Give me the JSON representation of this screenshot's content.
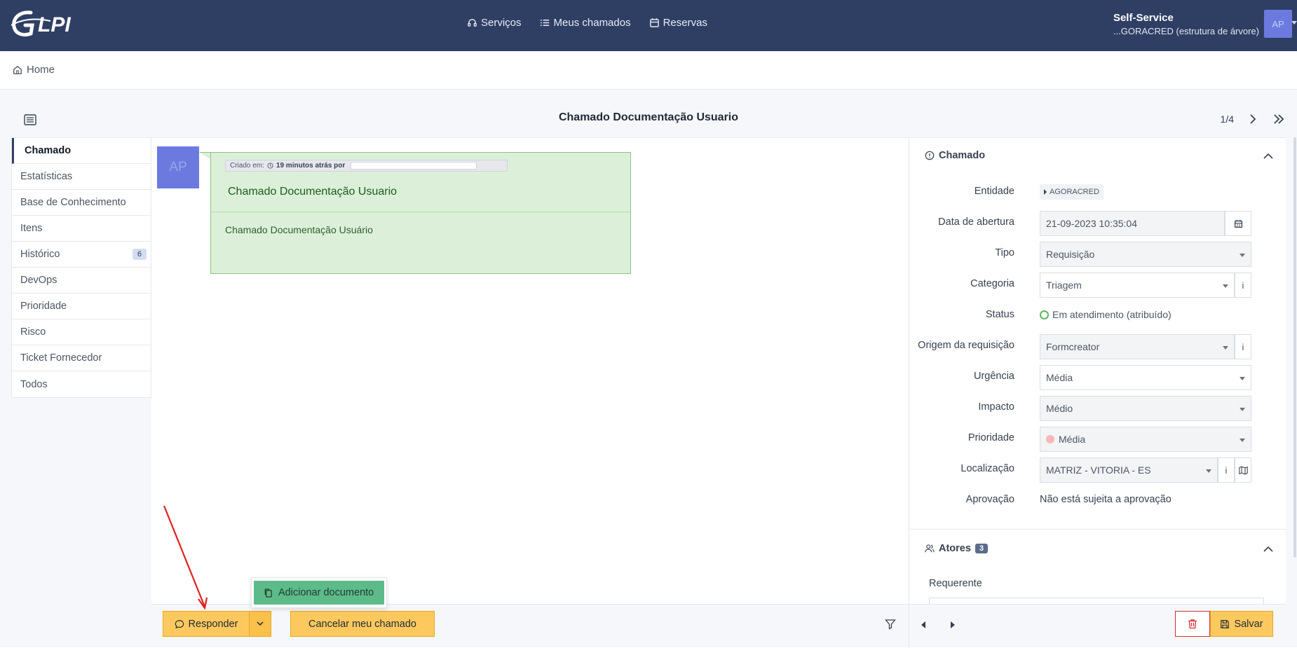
{
  "app": {
    "logo_text": "GLPI"
  },
  "topnav": {
    "items": [
      {
        "label": "Serviços",
        "icon": "headset-icon"
      },
      {
        "label": "Meus chamados",
        "icon": "list-icon"
      },
      {
        "label": "Reservas",
        "icon": "calendar-icon"
      }
    ]
  },
  "profile": {
    "title": "Self-Service",
    "entity": "...GORACRED (estrutura de árvore)",
    "avatar_initials": "AP"
  },
  "breadcrumb": {
    "home_label": "Home"
  },
  "page": {
    "title": "Chamado Documentação Usuario",
    "pager": "1/4"
  },
  "tabs": [
    {
      "label": "Chamado",
      "active": true
    },
    {
      "label": "Estatísticas"
    },
    {
      "label": "Base de Conhecimento"
    },
    {
      "label": "Itens"
    },
    {
      "label": "Histórico",
      "badge": "6"
    },
    {
      "label": "DevOps"
    },
    {
      "label": "Prioridade"
    },
    {
      "label": "Risco"
    },
    {
      "label": "Ticket Fornecedor"
    },
    {
      "label": "Todos"
    }
  ],
  "timeline": {
    "avatar_initials": "AP",
    "created_label": "Criado em:",
    "created_when": "19 minutos atrás por",
    "title": "Chamado Documentação Usuario",
    "body": "Chamado Documentação Usuário",
    "bubble_color": "#dcf0d9"
  },
  "ticket_panel": {
    "section_title": "Chamado",
    "fields": {
      "entidade_label": "Entidade",
      "entidade_value": "AGORACRED",
      "data_label": "Data de abertura",
      "data_value": "21-09-2023 10:35:04",
      "tipo_label": "Tipo",
      "tipo_value": "Requisição",
      "categoria_label": "Categoria",
      "categoria_value": "Triagem",
      "status_label": "Status",
      "status_value": "Em atendimento (atribuído)",
      "origem_label": "Origem da requisição",
      "origem_value": "Formcreator",
      "urgencia_label": "Urgência",
      "urgencia_value": "Média",
      "impacto_label": "Impacto",
      "impacto_value": "Médio",
      "prioridade_label": "Prioridade",
      "prioridade_value": "Média",
      "localizacao_label": "Localização",
      "localizacao_value": "MATRIZ - VITORIA - ES",
      "aprovacao_label": "Aprovação",
      "aprovacao_value": "Não está sujeita a aprovação"
    },
    "info_glyph": "i",
    "actors_title": "Atores",
    "actors_count": "3",
    "requerente_label": "Requerente"
  },
  "bottom": {
    "responder_label": "Responder",
    "cancel_label": "Cancelar meu chamado",
    "save_label": "Salvar"
  },
  "dropdown": {
    "add_document_label": "Adicionar documento"
  },
  "colors": {
    "navbar": "#2f3f64",
    "button_warning": "#fdc95e",
    "dropdown_active": "#5dbb8a",
    "annotation_arrow": "#e02020"
  }
}
